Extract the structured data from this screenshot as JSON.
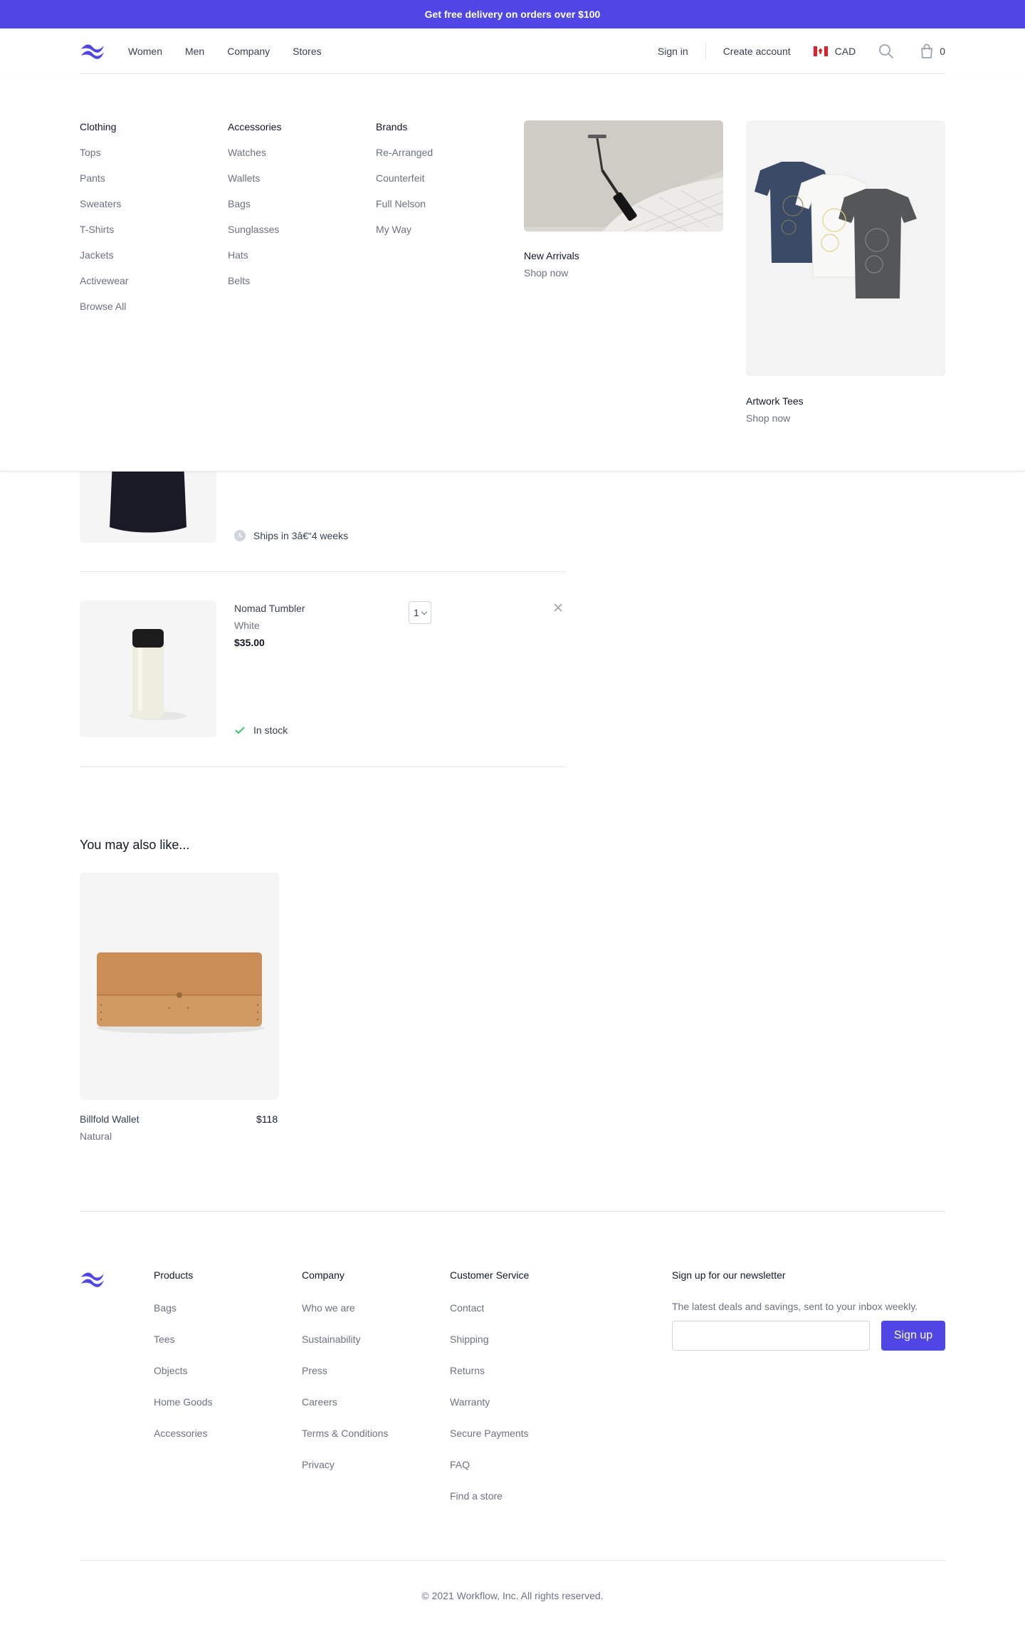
{
  "banner": {
    "text": "Get free delivery on orders over $100"
  },
  "colors": {
    "brand": "#4f46e5",
    "flag_red": "#e11d2a",
    "success": "#22c55e"
  },
  "nav": {
    "links": [
      "Women",
      "Men",
      "Company",
      "Stores"
    ],
    "sign_in": "Sign in",
    "create_account": "Create account",
    "currency": "CAD",
    "cart_count": "0",
    "icons": {
      "logo": "wave-logo-icon",
      "flag": "canada-flag-icon",
      "search": "search-icon",
      "cart": "shopping-bag-icon"
    }
  },
  "mega_menu": {
    "clothing": {
      "heading": "Clothing",
      "items": [
        "Tops",
        "Pants",
        "Sweaters",
        "T-Shirts",
        "Jackets",
        "Activewear",
        "Browse All"
      ]
    },
    "accessories": {
      "heading": "Accessories",
      "items": [
        "Watches",
        "Wallets",
        "Bags",
        "Sunglasses",
        "Hats",
        "Belts"
      ]
    },
    "brands": {
      "heading": "Brands",
      "items": [
        "Re-Arranged",
        "Counterfeit",
        "Full Nelson",
        "My Way"
      ]
    },
    "features": [
      {
        "title": "New Arrivals",
        "cta": "Shop now"
      },
      {
        "title": "Artwork Tees",
        "cta": "Shop now"
      }
    ]
  },
  "cart": {
    "items": [
      {
        "status": "Ships in 3â€“4 weeks"
      },
      {
        "name": "Nomad Tumbler",
        "color": "White",
        "price": "$35.00",
        "quantity": "1",
        "status": "In stock"
      }
    ]
  },
  "recommendations": {
    "heading": "You may also like...",
    "products": [
      {
        "name": "Billfold Wallet",
        "color": "Natural",
        "price": "$118"
      }
    ]
  },
  "footer": {
    "products": {
      "heading": "Products",
      "items": [
        "Bags",
        "Tees",
        "Objects",
        "Home Goods",
        "Accessories"
      ]
    },
    "company": {
      "heading": "Company",
      "items": [
        "Who we are",
        "Sustainability",
        "Press",
        "Careers",
        "Terms & Conditions",
        "Privacy"
      ]
    },
    "customer_service": {
      "heading": "Customer Service",
      "items": [
        "Contact",
        "Shipping",
        "Returns",
        "Warranty",
        "Secure Payments",
        "FAQ",
        "Find a store"
      ]
    },
    "newsletter": {
      "heading": "Sign up for our newsletter",
      "description": "The latest deals and savings, sent to your inbox weekly.",
      "placeholder": "",
      "button": "Sign up"
    },
    "copyright": "© 2021 Workflow, Inc. All rights reserved."
  }
}
